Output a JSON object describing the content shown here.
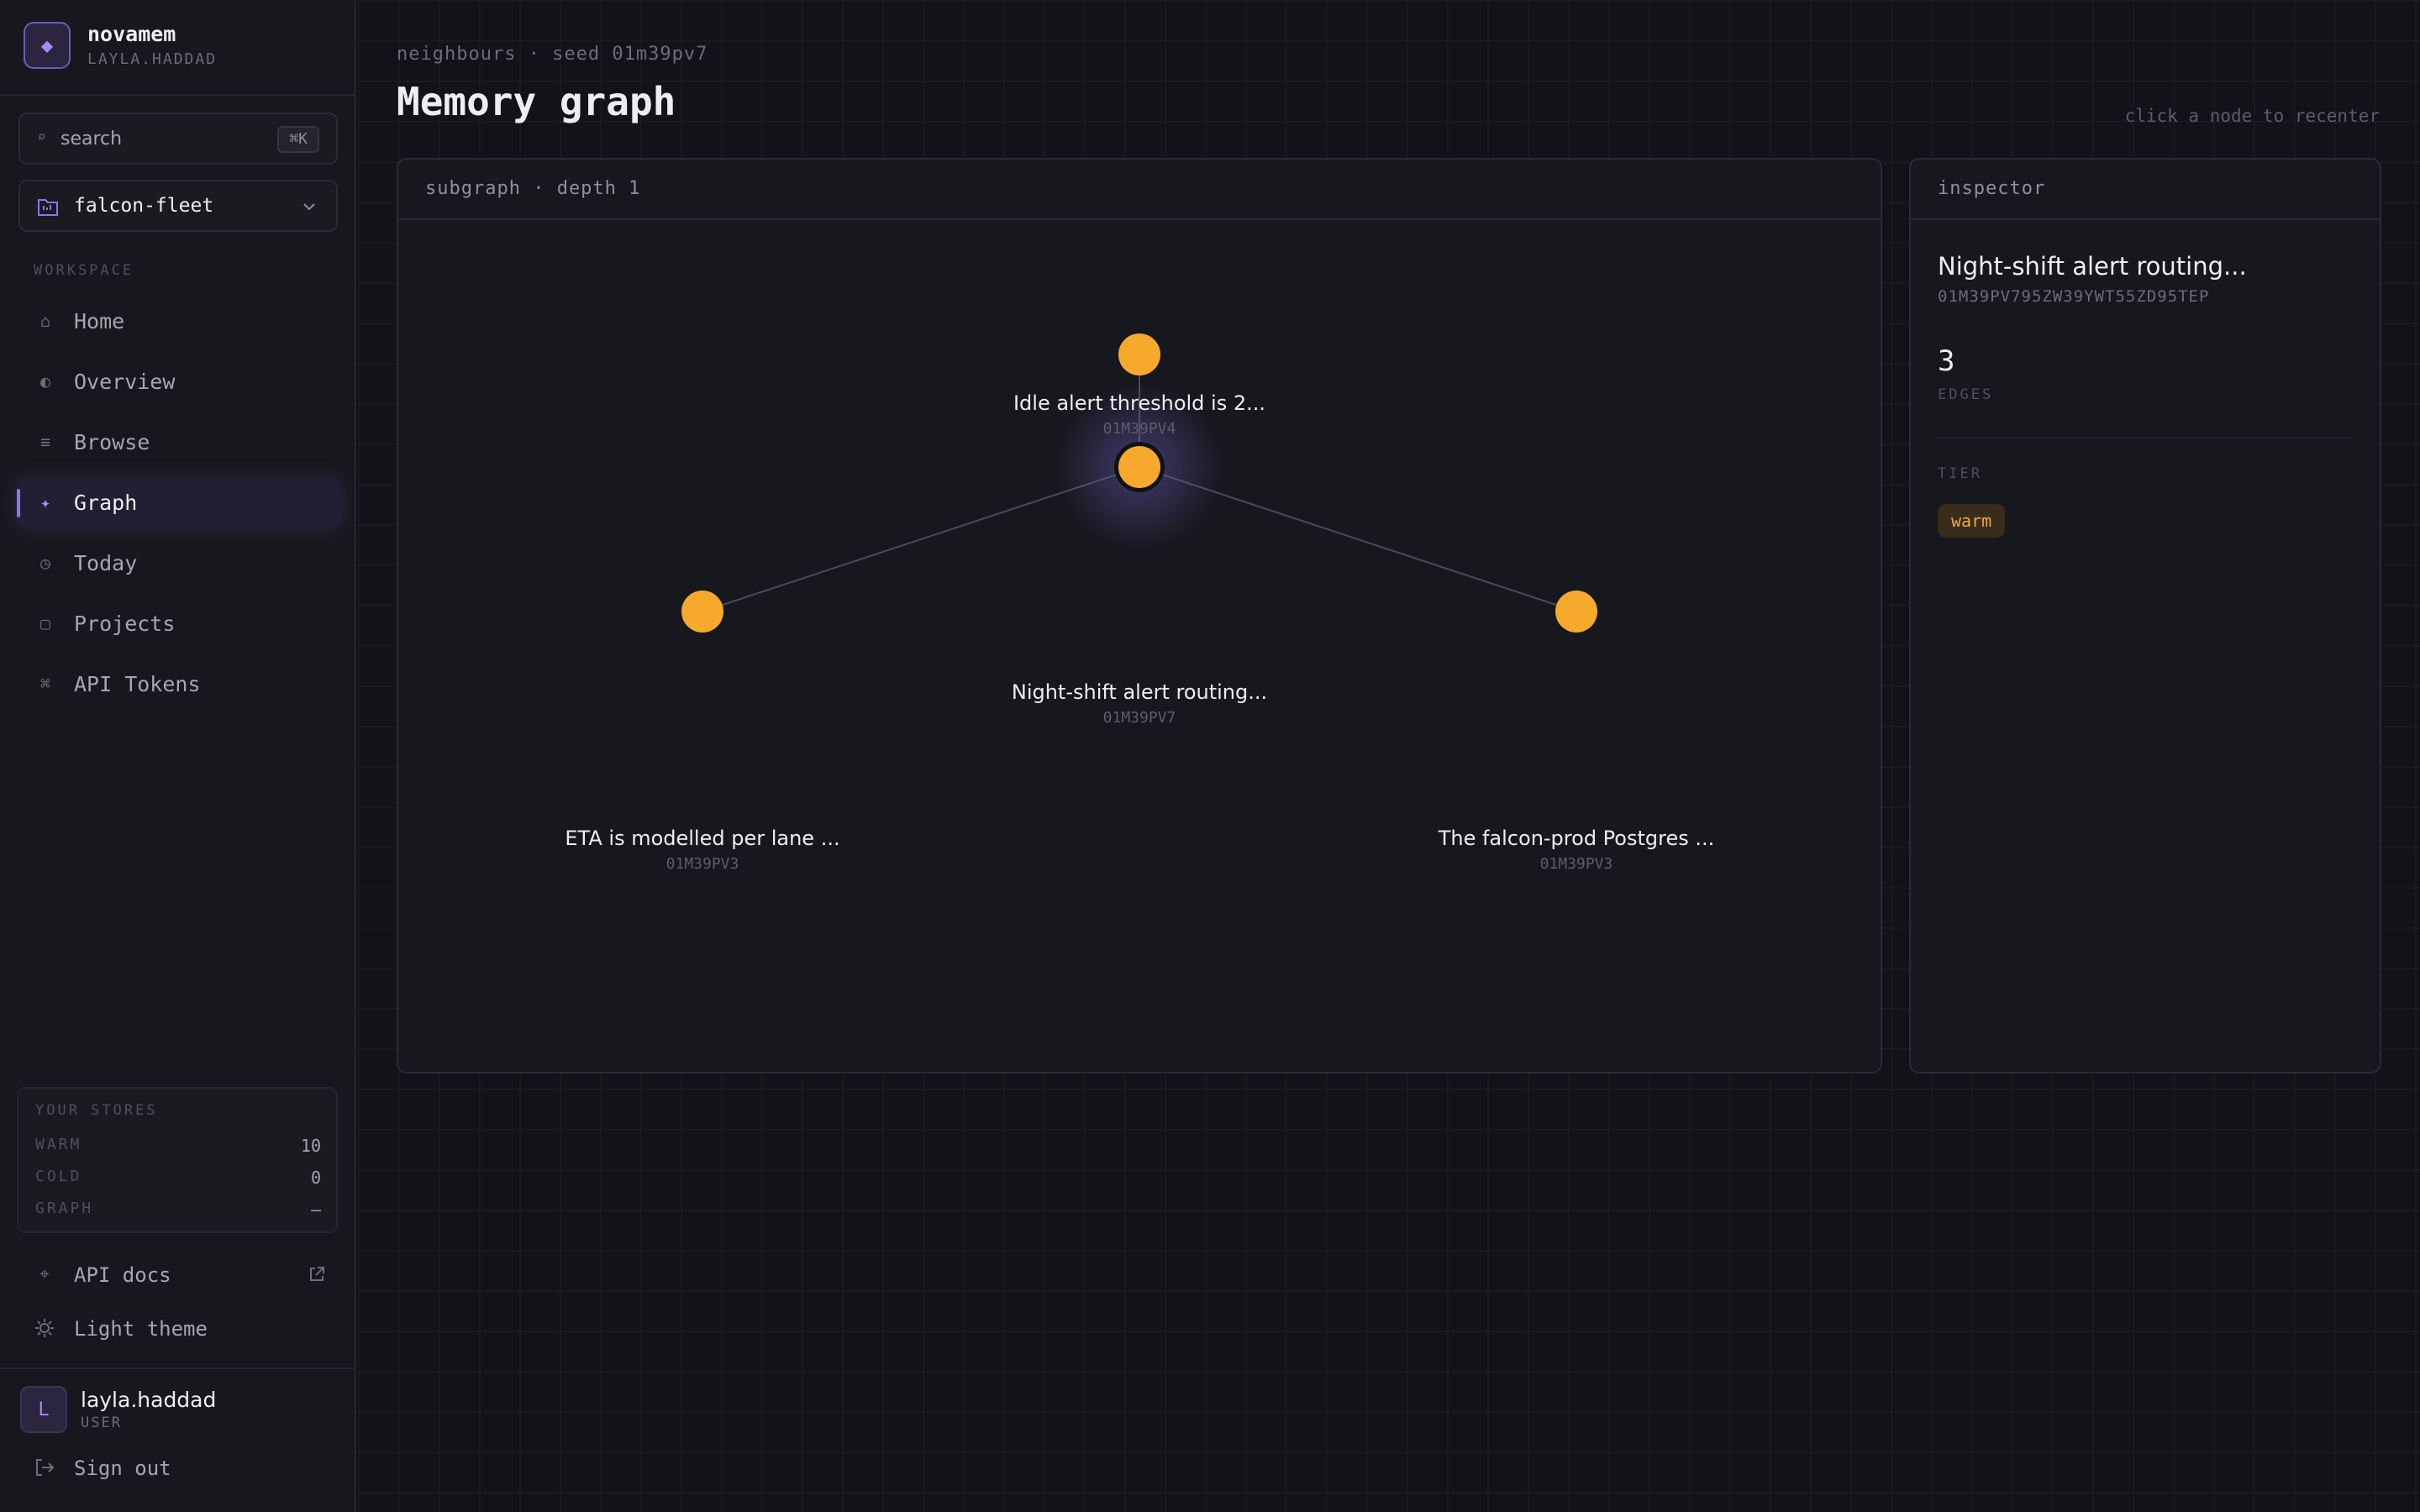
{
  "brand": {
    "name": "novamem",
    "user": "LAYLA.HADDAD",
    "logo_icon": "diamond-icon"
  },
  "search": {
    "label": "search",
    "shortcut": "⌘K"
  },
  "project": {
    "name": "falcon-fleet"
  },
  "workspace": {
    "label": "WORKSPACE",
    "items": [
      {
        "label": "Home",
        "icon": "home-icon",
        "active": false
      },
      {
        "label": "Overview",
        "icon": "overview-icon",
        "active": false
      },
      {
        "label": "Browse",
        "icon": "list-icon",
        "active": false
      },
      {
        "label": "Graph",
        "icon": "sparkle-icon",
        "active": true
      },
      {
        "label": "Today",
        "icon": "clock-icon",
        "active": false
      },
      {
        "label": "Projects",
        "icon": "square-icon",
        "active": false
      },
      {
        "label": "API Tokens",
        "icon": "command-icon",
        "active": false
      }
    ]
  },
  "stores": {
    "title": "YOUR STORES",
    "rows": [
      {
        "key": "WARM",
        "value": "10"
      },
      {
        "key": "COLD",
        "value": "0"
      },
      {
        "key": "GRAPH",
        "value": "–"
      }
    ]
  },
  "footer": {
    "api_docs": "API docs",
    "theme": "Light theme",
    "user_initial": "L",
    "user_name": "layla.haddad",
    "user_role": "USER",
    "sign_out": "Sign out"
  },
  "header": {
    "crumb": "neighbours · seed 01m39pv7",
    "title": "Memory graph",
    "hint": "click a node to recenter"
  },
  "graph": {
    "panel_title": "subgraph · depth 1",
    "node_color": "#f7a92e",
    "nodes": [
      {
        "label": "Idle alert threshold is 2...",
        "id": "01M39PV4"
      },
      {
        "label": "Night-shift alert routing...",
        "id": "01M39PV7",
        "seed": true
      },
      {
        "label": "ETA is modelled per lane ...",
        "id": "01M39PV3"
      },
      {
        "label": "The falcon-prod Postgres ...",
        "id": "01M39PV3"
      }
    ]
  },
  "inspector": {
    "panel_title": "inspector",
    "title": "Night-shift alert routing...",
    "id": "01M39PV795ZW39YWT55ZD95TEP",
    "edge_count": "3",
    "edge_label": "EDGES",
    "tier_label": "TIER",
    "tier": "warm"
  }
}
